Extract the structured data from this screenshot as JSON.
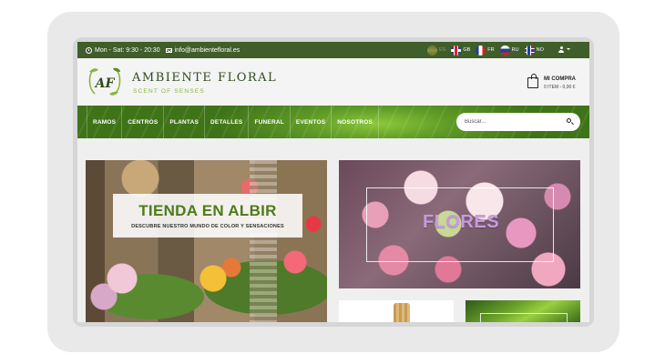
{
  "topbar": {
    "hours": "Mon - Sat: 9:30 - 20:30",
    "email": "info@ambientefloral.es",
    "languages": [
      {
        "code": "ES",
        "flag": "es-flag-icon",
        "active": false
      },
      {
        "code": "GB",
        "flag": "gb-flag-icon",
        "active": true
      },
      {
        "code": "FR",
        "flag": "fr-flag-icon",
        "active": true
      },
      {
        "code": "RU",
        "flag": "ru-flag-icon",
        "active": true
      },
      {
        "code": "NO",
        "flag": "no-flag-icon",
        "active": true
      }
    ]
  },
  "header": {
    "logo_text": "AF",
    "brand_name": "AMBIENTE FLORAL",
    "tagline": "SCENT OF SENSES",
    "cart_title": "MI COMPRA",
    "cart_summary": "0 ITEM - 0,00 €"
  },
  "nav": {
    "items": [
      "RAMOS",
      "CENTROS",
      "PLANTAS",
      "DETALLES",
      "FUNERAL",
      "EVENTOS",
      "NOSOTROS"
    ],
    "search_placeholder": "Buscar..."
  },
  "banners": {
    "store_title": "TIENDA EN ALBIR",
    "store_subtitle": "DESCUBRE NUESTRO MUNDO DE COLOR Y SENSACIONES",
    "flowers_title": "FLORES"
  },
  "colors": {
    "topbar": "#3f5e2a",
    "nav_green": "#5e9a26",
    "brand_dark": "#2f4a1e",
    "brand_light": "#8cb43a"
  }
}
